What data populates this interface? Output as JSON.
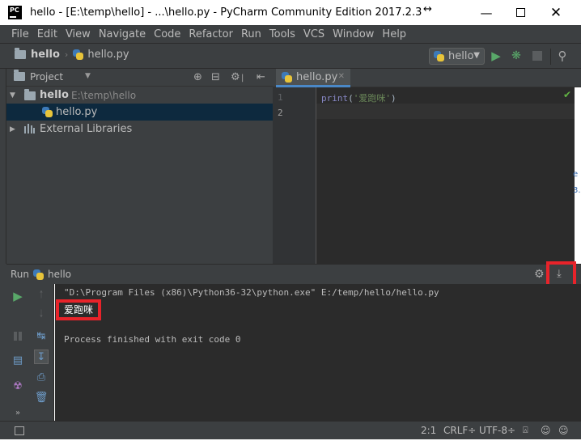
{
  "window": {
    "title": "hello - [E:\\temp\\hello] - ...\\hello.py - PyCharm Community Edition 2017.2.3",
    "logo_text": "PC",
    "resize_glyph": "↔"
  },
  "menu": [
    "File",
    "Edit",
    "View",
    "Navigate",
    "Code",
    "Refactor",
    "Run",
    "Tools",
    "VCS",
    "Window",
    "Help"
  ],
  "navbar": {
    "project": "hello",
    "file": "hello.py",
    "run_config": "hello"
  },
  "project_panel": {
    "title": "Project",
    "root_name": "hello",
    "root_path": "E:\\temp\\hello",
    "file": "hello.py",
    "libraries": "External Libraries"
  },
  "editor": {
    "tab": "hello.py",
    "lines": [
      "1",
      "2"
    ],
    "code_fn": "print",
    "code_open": "(",
    "code_string": "'爱跑咪'",
    "code_close": ")"
  },
  "run_panel": {
    "title": "Run",
    "config": "hello",
    "command": "\"D:\\Program Files (x86)\\Python36-32\\python.exe\" E:/temp/hello/hello.py",
    "output": "爱跑咪",
    "exit_message": "Process finished with exit code 0"
  },
  "status_bar": {
    "position": "2:1",
    "line_sep": "CRLF÷",
    "encoding": "UTF-8÷"
  },
  "colors": {
    "highlight": "#e8232a",
    "run_green": "#59a869",
    "accent_blue": "#4a88c7"
  }
}
